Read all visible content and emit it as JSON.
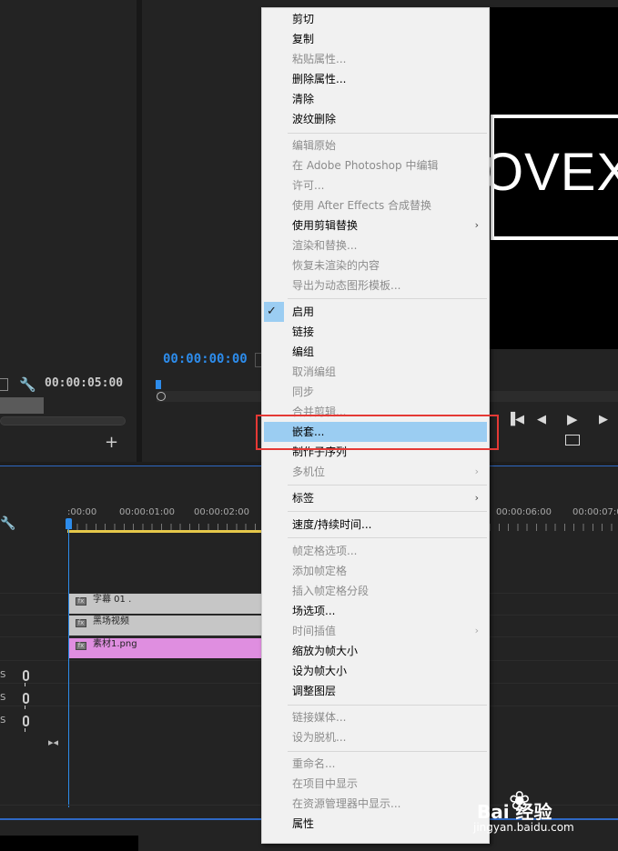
{
  "source_monitor": {
    "timecode": "00:00:05:00",
    "add_label": "+"
  },
  "program_monitor": {
    "timecode": "00:00:00:00",
    "video_text": "OVEX",
    "controls": {
      "step_back": "◀",
      "play": "▶",
      "step_forward": "▶"
    }
  },
  "timeline": {
    "ruler_labels": [
      ":00:00",
      "00:00:01:00",
      "00:00:02:00",
      "00:00:06:00",
      "00:00:07:0"
    ],
    "clips": {
      "title": "字幕 01",
      "title_suffix": ".",
      "black_video": "黑场视频",
      "image": "素材1.png",
      "fx_label": "fx"
    },
    "audio_tracks": [
      "S",
      "S",
      "S"
    ]
  },
  "context_menu": {
    "items": {
      "cut": "剪切",
      "copy": "复制",
      "paste_attributes": "粘贴属性...",
      "remove_attributes": "删除属性...",
      "clear": "清除",
      "ripple_delete": "波纹删除",
      "edit_original": "编辑原始",
      "edit_in_photoshop": "在 Adobe Photoshop 中编辑",
      "license": "许可...",
      "replace_with_after_effects": "使用 After Effects 合成替换",
      "replace_with_clip": "使用剪辑替换",
      "render_and_replace": "渲染和替换...",
      "restore_unrendered": "恢复未渲染的内容",
      "export_motion_graphics": "导出为动态图形模板...",
      "enable": "启用",
      "link": "链接",
      "group": "编组",
      "ungroup": "取消编组",
      "synchronize": "同步",
      "merge_clips": "合并剪辑...",
      "nest": "嵌套...",
      "make_subsequence": "制作子序列",
      "multi_camera": "多机位",
      "label": "标签",
      "speed_duration": "速度/持续时间...",
      "frame_hold_options": "帧定格选项...",
      "add_frame_hold": "添加帧定格",
      "insert_frame_hold_segment": "插入帧定格分段",
      "field_options": "场选项...",
      "time_interpolation": "时间插值",
      "scale_to_frame_size": "缩放为帧大小",
      "set_to_frame_size": "设为帧大小",
      "adjustment_layer": "调整图层",
      "link_media": "链接媒体...",
      "make_offline": "设为脱机...",
      "rename": "重命名...",
      "reveal_in_project": "在项目中显示",
      "reveal_in_explorer": "在资源管理器中显示...",
      "properties": "属性"
    },
    "check_mark": "✓",
    "submenu_arrow": "›"
  },
  "watermark": {
    "brand": "Bai  经验",
    "url": "jingyan.baidu.com"
  },
  "colors": {
    "accent_blue": "#2d8ceb",
    "menu_highlight": "#9bcdf2",
    "annotation_red": "#e53935",
    "clip_pink": "#df8ee0",
    "clip_gray": "#c6c6c6"
  }
}
